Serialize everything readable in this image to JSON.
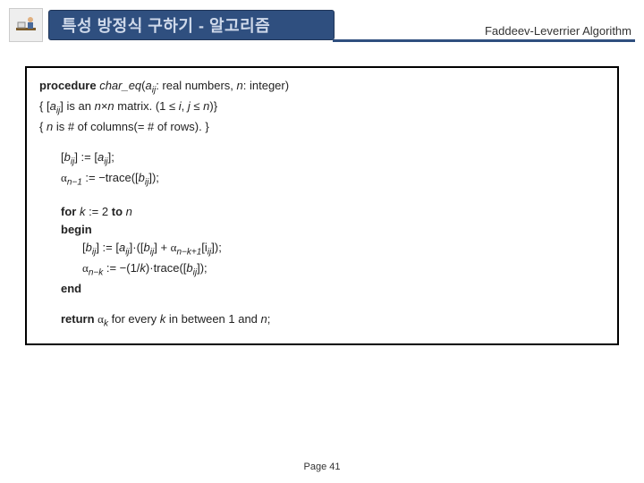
{
  "title": "특성 방정식 구하기 - 알고리즘",
  "subtitle": "Faddeev-Leverrier Algorithm",
  "icon_name": "person-desk-icon",
  "proc": {
    "decl_prefix": "procedure ",
    "decl_name": "char_eq",
    "decl_args_open": "(",
    "decl_a": "a",
    "decl_ij": "ij",
    "decl_mid": ": real numbers, ",
    "decl_n": "n",
    "decl_end": ": integer)",
    "comment1_open": "{ [",
    "comment1_a": "a",
    "comment1_ij": "ij",
    "comment1_mid": "] is an ",
    "comment1_nxn": "n×n",
    "comment1_rest": " matrix. (1 ≤ ",
    "comment1_i": "i",
    "comment1_comma": ", ",
    "comment1_j": "j",
    "comment1_le": " ≤ ",
    "comment1_n2": "n",
    "comment1_close": ")}",
    "comment2_open": "{ ",
    "comment2_n": "n",
    "comment2_rest": " is # of columns(= # of rows). }"
  },
  "init": {
    "l1_open": "[",
    "l1_b": "b",
    "l1_ij": "ij",
    "l1_mid": "] := [",
    "l1_a": "a",
    "l1_ij2": "ij",
    "l1_close": "];",
    "l2_alpha": "α",
    "l2_sub": "n−1",
    "l2_mid": " := −trace([",
    "l2_b": "b",
    "l2_ij": "ij",
    "l2_close": "]);"
  },
  "loop": {
    "for_kw": "for ",
    "for_k": "k",
    "for_mid": " := 2 ",
    "to_kw": "to ",
    "for_n": "n",
    "begin_kw": "begin",
    "l1_open": "[",
    "l1_b": "b",
    "l1_ij": "ij",
    "l1_mid": "] := [",
    "l1_a": "a",
    "l1_ij2": "ij",
    "l1_dot": "]·([",
    "l1_b2": "b",
    "l1_ij3": "ij",
    "l1_plus": "] + ",
    "l1_alpha": "α",
    "l1_asub": "n−k+1",
    "l1_I": "[i",
    "l1_Isub": "ij",
    "l1_close": "]);",
    "l2_alpha": "α",
    "l2_asub": "n−k",
    "l2_mid": " := −(1/",
    "l2_k": "k",
    "l2_dot": ")·trace([",
    "l2_b": "b",
    "l2_ij": "ij",
    "l2_close": "]);",
    "end_kw": "end"
  },
  "ret": {
    "kw": "return ",
    "alpha": "α",
    "k": "k",
    "mid": " for every ",
    "kv": "k",
    "rest": " in between 1 and ",
    "n": "n",
    "semi": ";"
  },
  "page": "Page 41"
}
